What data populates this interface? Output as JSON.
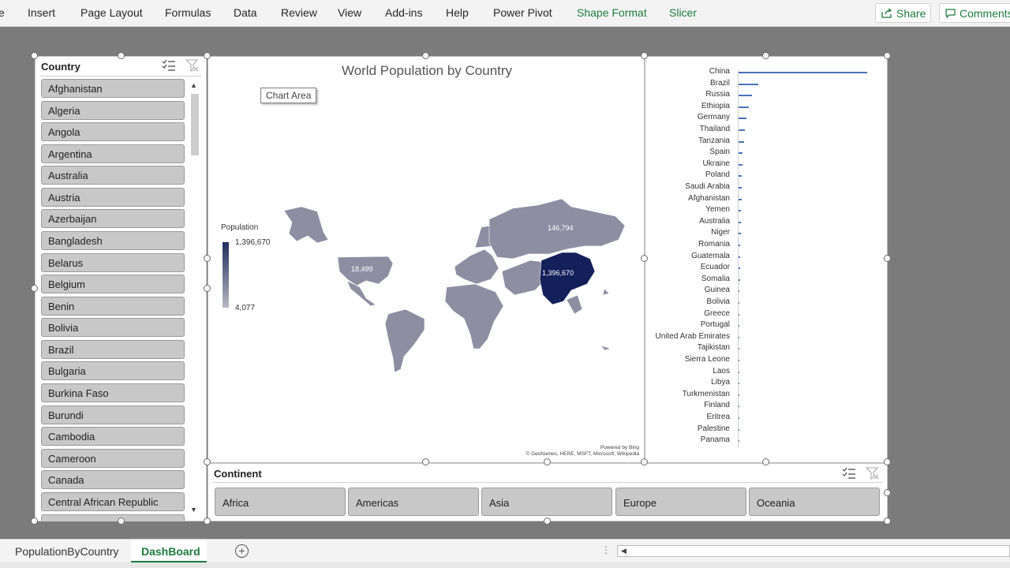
{
  "ribbon": {
    "tabs": [
      "e",
      "Insert",
      "Page Layout",
      "Formulas",
      "Data",
      "Review",
      "View",
      "Add-ins",
      "Help",
      "Power Pivot"
    ],
    "context_tabs": [
      "Shape Format",
      "Slicer"
    ],
    "share_label": "Share",
    "comments_label": "Comments"
  },
  "country_slicer": {
    "title": "Country",
    "items": [
      "Afghanistan",
      "Algeria",
      "Angola",
      "Argentina",
      "Australia",
      "Austria",
      "Azerbaijan",
      "Bangladesh",
      "Belarus",
      "Belgium",
      "Benin",
      "Bolivia",
      "Brazil",
      "Bulgaria",
      "Burkina Faso",
      "Burundi",
      "Cambodia",
      "Cameroon",
      "Canada",
      "Central African Republic"
    ]
  },
  "map_chart": {
    "title": "World Population by Country",
    "tooltip": "Chart Area",
    "legend_title": "Population",
    "legend_max": "1,396,670",
    "legend_min": "4,077",
    "labels": {
      "usa": "18,499",
      "russia": "146,794",
      "china": "1,396,670"
    },
    "credit_line1": "Powered by Bing",
    "credit_line2": "© GeoNames, HERE, MSFT, Microsoft, Wikipedia",
    "colors": {
      "low": "#b8b8c2",
      "high": "#1f2d5e",
      "mid": "#8e8ea3"
    }
  },
  "chart_data": {
    "type": "bar",
    "orientation": "horizontal",
    "categories": [
      "China",
      "Brazil",
      "Russia",
      "Ethiopia",
      "Germany",
      "Thailand",
      "Tanzania",
      "Spain",
      "Ukraine",
      "Poland",
      "Saudi Arabia",
      "Afghanistan",
      "Yemen",
      "Australia",
      "Niger",
      "Romania",
      "Guatemala",
      "Ecuador",
      "Somalia",
      "Guinea",
      "Bolivia",
      "Greece",
      "Portugal",
      "United Arab Emirates",
      "Tajikistan",
      "Sierra Leone",
      "Laos",
      "Libya",
      "Turkmenistan",
      "Finland",
      "Eritrea",
      "Palestine",
      "Panama"
    ],
    "values": [
      1396670,
      211050,
      145870,
      112080,
      83090,
      69630,
      58010,
      47080,
      44390,
      37970,
      34270,
      38040,
      29160,
      25370,
      23310,
      19360,
      16600,
      17370,
      15440,
      12770,
      11510,
      10720,
      10270,
      9770,
      9320,
      7810,
      7170,
      6780,
      5940,
      5520,
      3500,
      4980,
      4250
    ],
    "bar_color": "#4a73b8"
  },
  "continent_slicer": {
    "title": "Continent",
    "items": [
      "Africa",
      "Americas",
      "Asia",
      "Europe",
      "Oceania"
    ]
  },
  "sheets": {
    "tabs": [
      "PopulationByCountry",
      "DashBoard"
    ],
    "active": "DashBoard"
  }
}
